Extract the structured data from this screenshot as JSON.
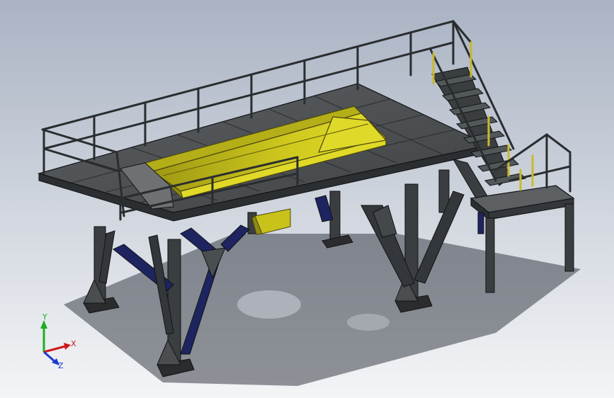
{
  "app": {
    "view": "isometric",
    "display_mode": "shaded-with-edges"
  },
  "colors": {
    "background_top": "#a9b3c3",
    "background_bottom": "#f4f5f7",
    "steel": "#3b3e40",
    "steel_light": "#5c6063",
    "steel_dark": "#1e2021",
    "brace_blue": "#1d2460",
    "hopper_yellow": "#c8c21a",
    "hopper_yellow_dark": "#8f8a12",
    "rail_yellow": "#c9b92a",
    "axis_x": "#d01818",
    "axis_y": "#1fae1f",
    "axis_z": "#1a3ad0"
  },
  "triad": {
    "x_label": "X",
    "y_label": "Y",
    "z_label": "Z"
  }
}
